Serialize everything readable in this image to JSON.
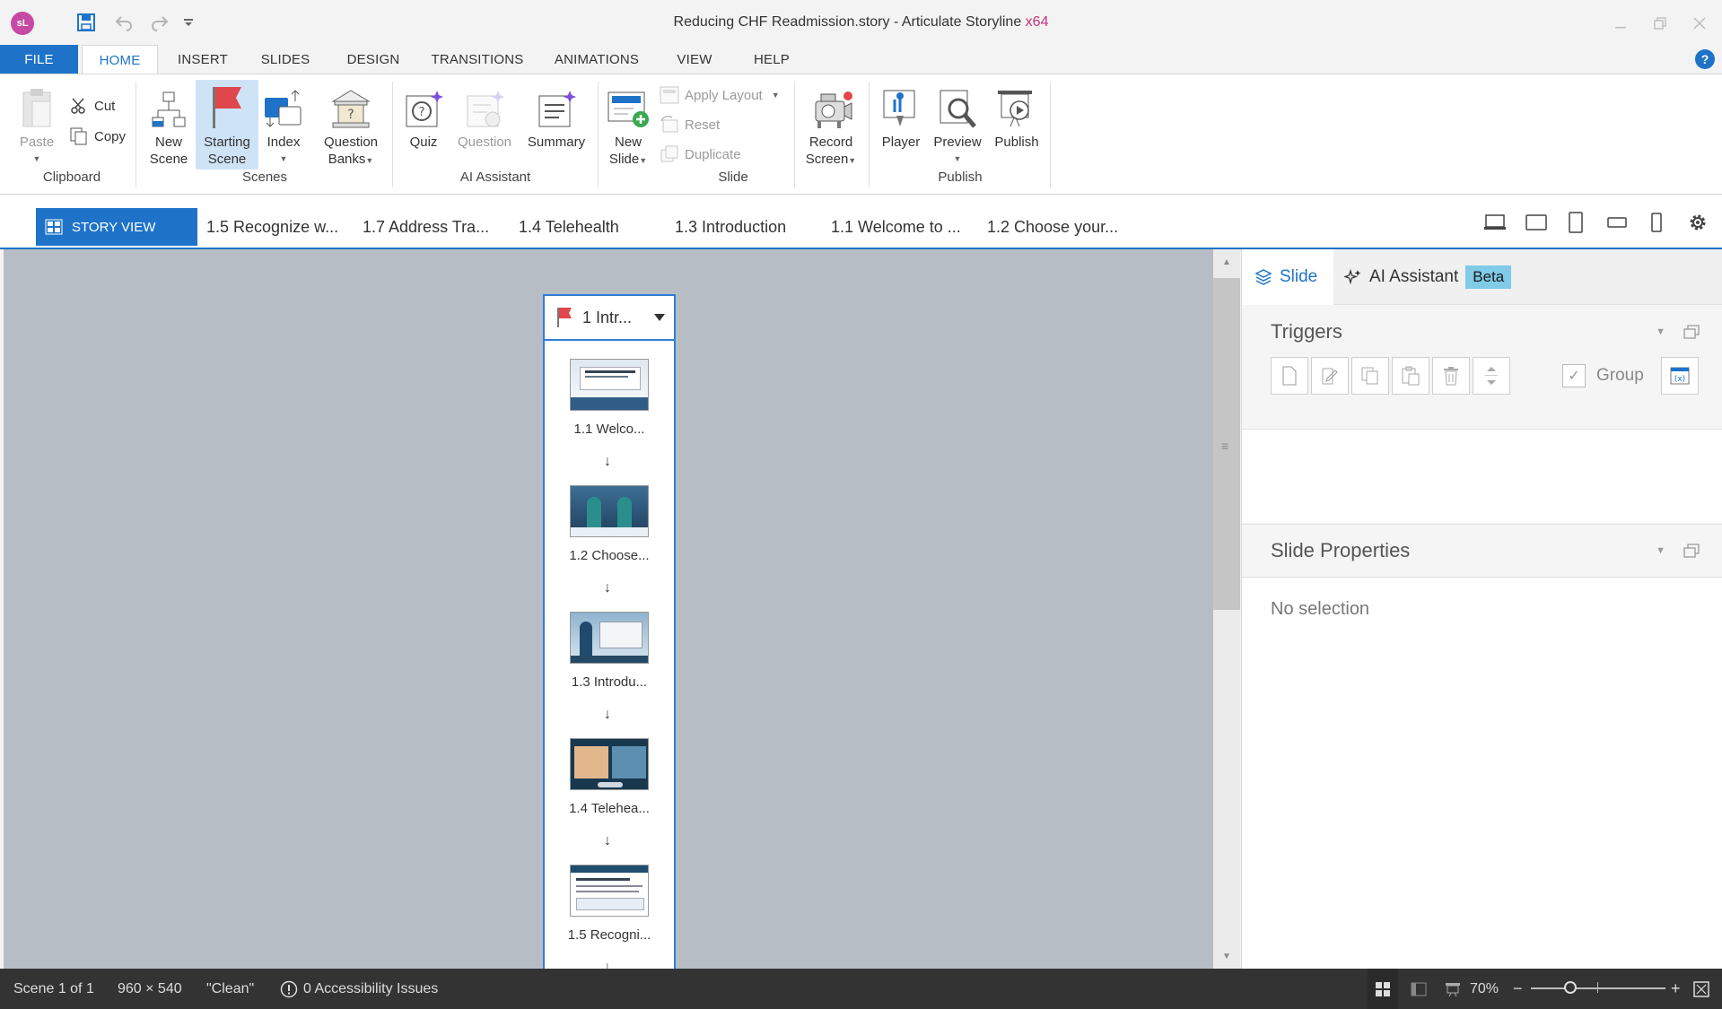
{
  "titlebar": {
    "logo": "sL",
    "title": "Reducing CHF Readmission.story - Articulate Storyline",
    "arch": "x64",
    "icons": [
      "save-icon",
      "undo-icon",
      "redo-icon",
      "customize-qat-icon",
      "minimize-icon",
      "restore-icon",
      "close-icon"
    ]
  },
  "tabs": [
    "FILE",
    "HOME",
    "INSERT",
    "SLIDES",
    "DESIGN",
    "TRANSITIONS",
    "ANIMATIONS",
    "VIEW",
    "HELP"
  ],
  "help": "?",
  "ribbon": {
    "clipboard": {
      "paste": "Paste",
      "cut": "Cut",
      "copy": "Copy",
      "label": "Clipboard"
    },
    "scenes": {
      "new_scene_1": "New",
      "new_scene_2": "Scene",
      "starting_1": "Starting",
      "starting_2": "Scene",
      "index": "Index",
      "qbanks_1": "Question",
      "qbanks_2": "Banks",
      "label": "Scenes"
    },
    "ai": {
      "quiz": "Quiz",
      "question": "Question",
      "summary": "Summary",
      "label": "AI Assistant"
    },
    "slide": {
      "new_slide_1": "New",
      "new_slide_2": "Slide",
      "apply_layout": "Apply Layout",
      "reset": "Reset",
      "duplicate": "Duplicate",
      "label": "Slide"
    },
    "record": {
      "line1": "Record",
      "line2": "Screen"
    },
    "publish": {
      "player": "Player",
      "preview": "Preview",
      "publish": "Publish",
      "label": "Publish"
    }
  },
  "storytabs": {
    "story_view": "STORY VIEW",
    "slides": [
      "1.5 Recognize w...",
      "1.7 Address Tra...",
      "1.4 Telehealth",
      "1.3 Introduction",
      "1.1 Welcome to ...",
      "1.2 Choose your..."
    ]
  },
  "scene": {
    "title": "1 Intr...",
    "slides": [
      "1.1 Welco...",
      "1.2 Choose...",
      "1.3 Introdu...",
      "1.4 Telehea...",
      "1.5 Recogni..."
    ],
    "arrow": "↓"
  },
  "rpanel": {
    "tab_slide": "Slide",
    "tab_ai": "AI Assistant",
    "beta": "Beta",
    "triggers": "Triggers",
    "group": "Group",
    "slide_properties": "Slide Properties",
    "no_selection": "No selection"
  },
  "status": {
    "scene": "Scene 1 of 1",
    "size": "960 × 540",
    "theme": "\"Clean\"",
    "accessibility": "0 Accessibility Issues",
    "zoom": "70%",
    "zoom_level": 0.7
  },
  "colors": {
    "accent": "#1e73c9",
    "brand": "#c64aa3",
    "canvas": "#b6bdc5",
    "flag": "#e0474c"
  }
}
